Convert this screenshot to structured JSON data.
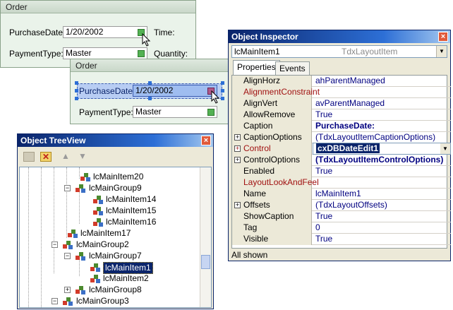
{
  "order_back": {
    "title": "Order",
    "purchase_label": "PurchaseDate:",
    "purchase_value": "1/20/2002",
    "time_label": "Time:",
    "payment_label": "PaymentType:",
    "payment_value": "Master",
    "quantity_label": "Quantity:"
  },
  "order_front": {
    "title": "Order",
    "purchase_label": "PurchaseDate:",
    "purchase_value": "1/20/2002",
    "payment_label": "PaymentType:",
    "payment_value": "Master"
  },
  "inspector": {
    "title": "Object Inspector",
    "close": "×",
    "component_name": "lcMainItem1",
    "component_type": "TdxLayoutItem",
    "tabs": [
      "Properties",
      "Events"
    ],
    "rows": [
      {
        "name": "AlignHorz",
        "value": "ahParentManaged"
      },
      {
        "name": "AlignmentConstraint",
        "value": ""
      },
      {
        "name": "AlignVert",
        "value": "avParentManaged"
      },
      {
        "name": "AllowRemove",
        "value": "True"
      },
      {
        "name": "Caption",
        "value": "PurchaseDate:"
      },
      {
        "name": "CaptionOptions",
        "value": "(TdxLayoutItemCaptionOptions)"
      },
      {
        "name": "Control",
        "value": "cxDBDateEdit1"
      },
      {
        "name": "ControlOptions",
        "value": "(TdxLayoutItemControlOptions)"
      },
      {
        "name": "Enabled",
        "value": "True"
      },
      {
        "name": "LayoutLookAndFeel",
        "value": ""
      },
      {
        "name": "Name",
        "value": "lcMainItem1"
      },
      {
        "name": "Offsets",
        "value": "(TdxLayoutOffsets)"
      },
      {
        "name": "ShowCaption",
        "value": "True"
      },
      {
        "name": "Tag",
        "value": "0"
      },
      {
        "name": "Visible",
        "value": "True"
      }
    ],
    "status": "All shown"
  },
  "treeview": {
    "title": "Object TreeView",
    "close": "×",
    "items": [
      {
        "label": "lcMainItem20"
      },
      {
        "label": "lcMainGroup9"
      },
      {
        "label": "lcMainItem14"
      },
      {
        "label": "lcMainItem15"
      },
      {
        "label": "lcMainItem16"
      },
      {
        "label": "lcMainItem17"
      },
      {
        "label": "lcMainGroup2"
      },
      {
        "label": "lcMainGroup7"
      },
      {
        "label": "lcMainItem1"
      },
      {
        "label": "lcMainItem2"
      },
      {
        "label": "lcMainGroup8"
      },
      {
        "label": "lcMainGroup3"
      }
    ]
  },
  "colors": {
    "title_active": "#0a246a",
    "selection": "#0a246a",
    "value_text": "#000080",
    "panel_bg": "#eaf3ea"
  }
}
